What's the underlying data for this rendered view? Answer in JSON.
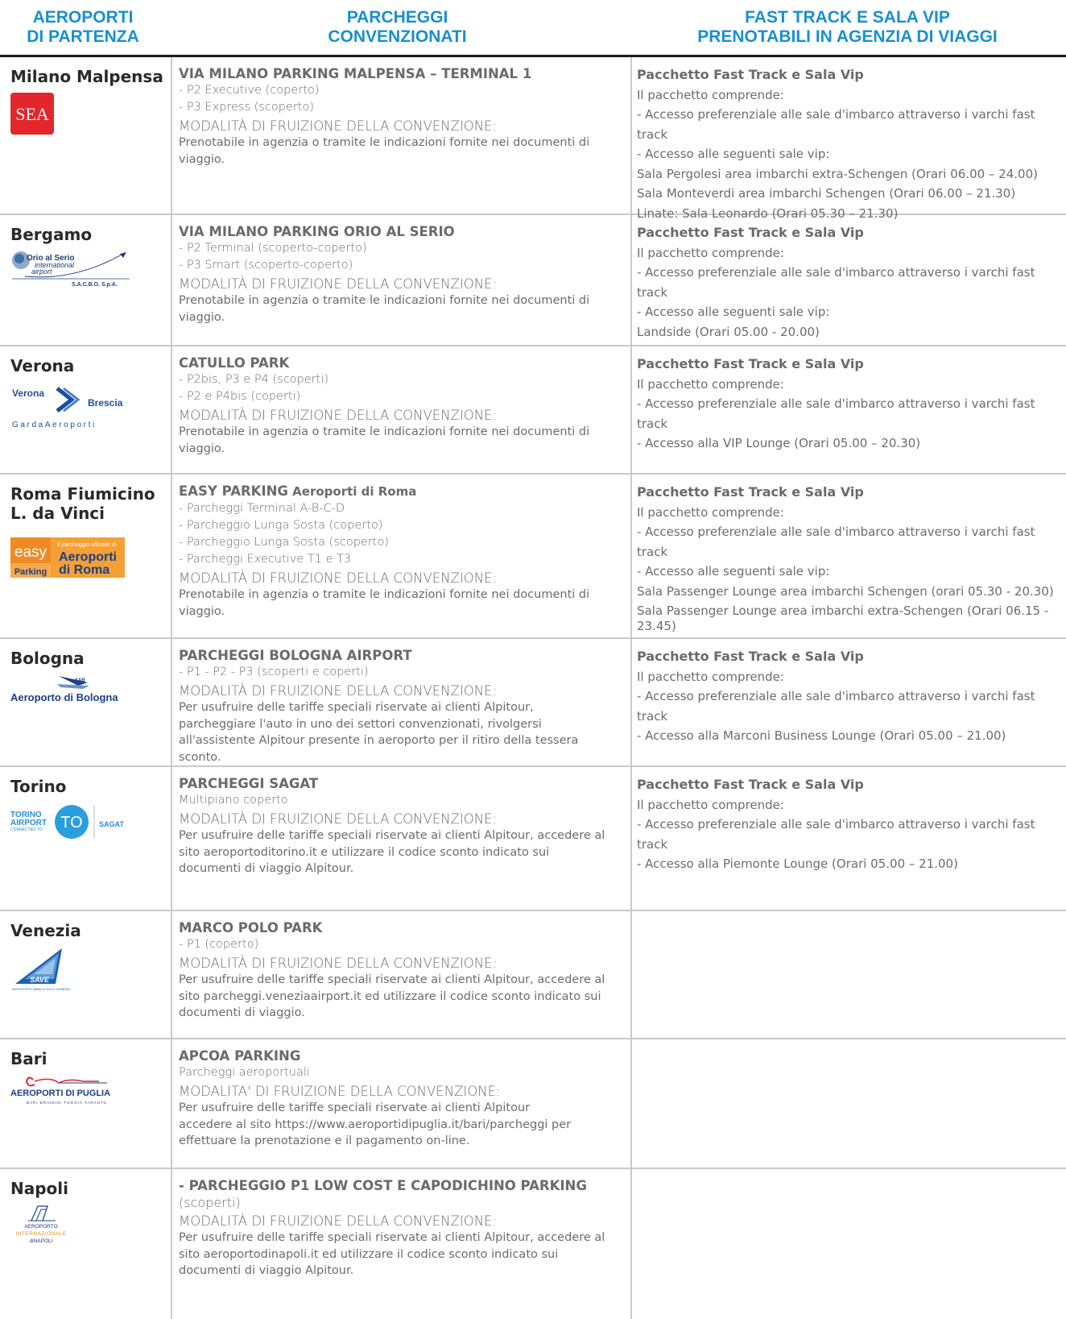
{
  "header": {
    "col1": [
      "AEROPORTI",
      "DI PARTENZA"
    ],
    "col2": [
      "PARCHEGGI",
      "CONVENZIONATI"
    ],
    "col3": [
      "FAST TRACK E SALA VIP",
      "PRENOTABILI IN AGENZIA DI VIAGGI"
    ]
  },
  "common": {
    "modalita": "MODALITÀ DI FRUIZIONE DELLA CONVENZIONE:",
    "modalita_bari": "MODALITA' DI FRUIZIONE DELLA CONVENZIONE:",
    "prenotabile": "Prenotabile in agenzia o tramite le indicazioni fornite nei documenti di viaggio.",
    "pacchetto": "Pacchetto Fast Track e Sala Vip",
    "comprende": "Il pacchetto comprende:",
    "accesso_fast": "- Accesso preferenziale alle sale d'imbarco attraverso i varchi fast track",
    "accesso_sale": "- Accesso alle seguenti sale vip:"
  },
  "rows": {
    "malpensa": {
      "airport": "Milano Malpensa",
      "logo_text": "SEA",
      "parking_title": "VIA MILANO PARKING MALPENSA – TERMINAL 1",
      "parking_lines": [
        "- P2 Executive (coperto)",
        "- P3 Express (scoperto)"
      ],
      "vip_lines": [
        "- Accesso preferenziale alle sale d'imbarco attraverso i varchi fast track",
        "- Accesso alle seguenti sale vip:",
        "Sala Pergolesi area imbarchi extra-Schengen (Orari 06.00 – 24.00)",
        "Sala Monteverdi area imbarchi Schengen (Orari 06.00 – 21.30)",
        "Linate: Sala Leonardo (Orari 05.30 – 21.30)"
      ]
    },
    "bergamo": {
      "airport": "Bergamo",
      "logo_text": [
        "Orio al Serio",
        "international",
        "airport",
        "S.A.C.B.O. S.p.A."
      ],
      "parking_title": "VIA MILANO PARKING ORIO AL SERIO",
      "parking_lines": [
        "- P2 Terminal (scoperto-coperto)",
        "- P3 Smart (scoperto-coperto)"
      ],
      "vip_lines": [
        "- Accesso preferenziale alle sale d'imbarco attraverso i varchi fast track",
        "- Accesso alle seguenti sale vip:",
        "Landside (Orari 05.00 - 20.00)"
      ]
    },
    "verona": {
      "airport": "Verona",
      "logo_text": [
        "Verona",
        "Brescia",
        "GardaAeroporti"
      ],
      "parking_title": "CATULLO PARK",
      "parking_lines": [
        "- P2bis, P3 e P4 (scoperti)",
        "- P2 e P4bis (coperti)"
      ],
      "vip_lines": [
        "- Accesso preferenziale alle sale d'imbarco attraverso i varchi fast track",
        "- Accesso alla VIP Lounge (Orari 05.00 – 20.30)"
      ]
    },
    "roma": {
      "airport": [
        "Roma Fiumicino",
        "L. da Vinci"
      ],
      "logo_text": [
        "easy",
        "Parking",
        "Il parcheggio ufficiale di",
        "Aeroporti",
        "di Roma"
      ],
      "parking_title": "EASY PARKING",
      "parking_title_sub": " Aeroporti di Roma",
      "parking_lines": [
        "- Parcheggi Terminal A-B-C-D",
        "- Parcheggio Lunga Sosta (coperto)",
        "- Parcheggio Lunga Sosta (scoperto)",
        "- Parcheggi Executive T1 e T3"
      ],
      "vip_lines": [
        "- Accesso preferenziale alle sale d'imbarco attraverso i varchi fast track",
        "- Accesso alle seguenti sale vip:",
        "Sala Passenger Lounge area imbarchi Schengen (orari 05.30 - 20.30)"
      ],
      "vip_last": "Sala Passenger Lounge area imbarchi extra-Schengen (Orari 06.15 - 23.45)"
    },
    "bologna": {
      "airport": "Bologna",
      "logo_text": [
        "SAB",
        "Aeroporto di Bologna"
      ],
      "parking_title": "PARCHEGGI BOLOGNA AIRPORT",
      "parking_lines": [
        "- P1 - P2 - P3 (scoperti e coperti)"
      ],
      "desc": "Per usufruire delle tariffe speciali riservate ai clienti Alpitour, parcheggiare l'auto in uno dei settori convenzionati, rivolgersi all'assistente Alpitour presente in aeroporto per il ritiro della tessera sconto.",
      "vip_lines": [
        "- Accesso preferenziale alle sale d'imbarco attraverso i varchi fast track",
        "- Accesso alla Marconi Business Lounge (Orari 05.00 – 21.00)"
      ]
    },
    "torino": {
      "airport": "Torino",
      "logo_text": [
        "TORINO",
        "AIRPORT",
        "CONNECTED TO",
        "TO",
        "SAGAT"
      ],
      "parking_title": "PARCHEGGI SAGAT",
      "parking_lines": [
        "Multipiano coperto"
      ],
      "desc": "Per usufruire delle tariffe speciali riservate ai clienti Alpitour, accedere al sito aeroportoditorino.it e utilizzare il codice sconto indicato sui documenti di viaggio Alpitour.",
      "vip_lines": [
        "- Accesso preferenziale alle sale d'imbarco attraverso i varchi fast track",
        "- Accesso alla Piemonte Lounge (Orari 05.00 – 21.00)"
      ]
    },
    "venezia": {
      "airport": "Venezia",
      "logo_text": [
        "SAVE",
        "AEROPORTO MARCO POLO VENEZIA"
      ],
      "parking_title": "MARCO POLO PARK",
      "parking_lines": [
        "- P1 (coperto)"
      ],
      "desc": "Per usufruire delle tariffe speciali riservate ai clienti Alpitour, accedere al sito parcheggi.veneziaairport.it ed utilizzare il codice sconto indicato sui documenti di viaggio."
    },
    "bari": {
      "airport": "Bari",
      "logo_text": [
        "AEROPORTI DI PUGLIA",
        "BARI BRINDISI FOGGIA TARANTO"
      ],
      "parking_title": "APCOA PARKING",
      "parking_lines": [
        "Parcheggi aeroportuali"
      ],
      "desc": "Per usufruire delle tariffe speciali riservate ai clienti Alpitour accedere al sito https://www.aeroportidipuglia.it/bari/parcheggi per effettuare la prenotazione e il pagamento on-line."
    },
    "napoli": {
      "airport": "Napoli",
      "logo_text": [
        "AEROPORTO",
        "INTERNAZIONALE",
        "diNAPOLI"
      ],
      "parking_title": "- PARCHEGGIO P1 LOW COST E CAPODICHINO PARKING",
      "parking_lines": [
        "(scoperti)"
      ],
      "desc": "Per usufruire delle tariffe speciali riservate ai clienti Alpitour, accedere al sito aeroportodinapoli.it ed utilizzare il codice sconto indicato sui documenti di viaggio Alpitour."
    }
  }
}
